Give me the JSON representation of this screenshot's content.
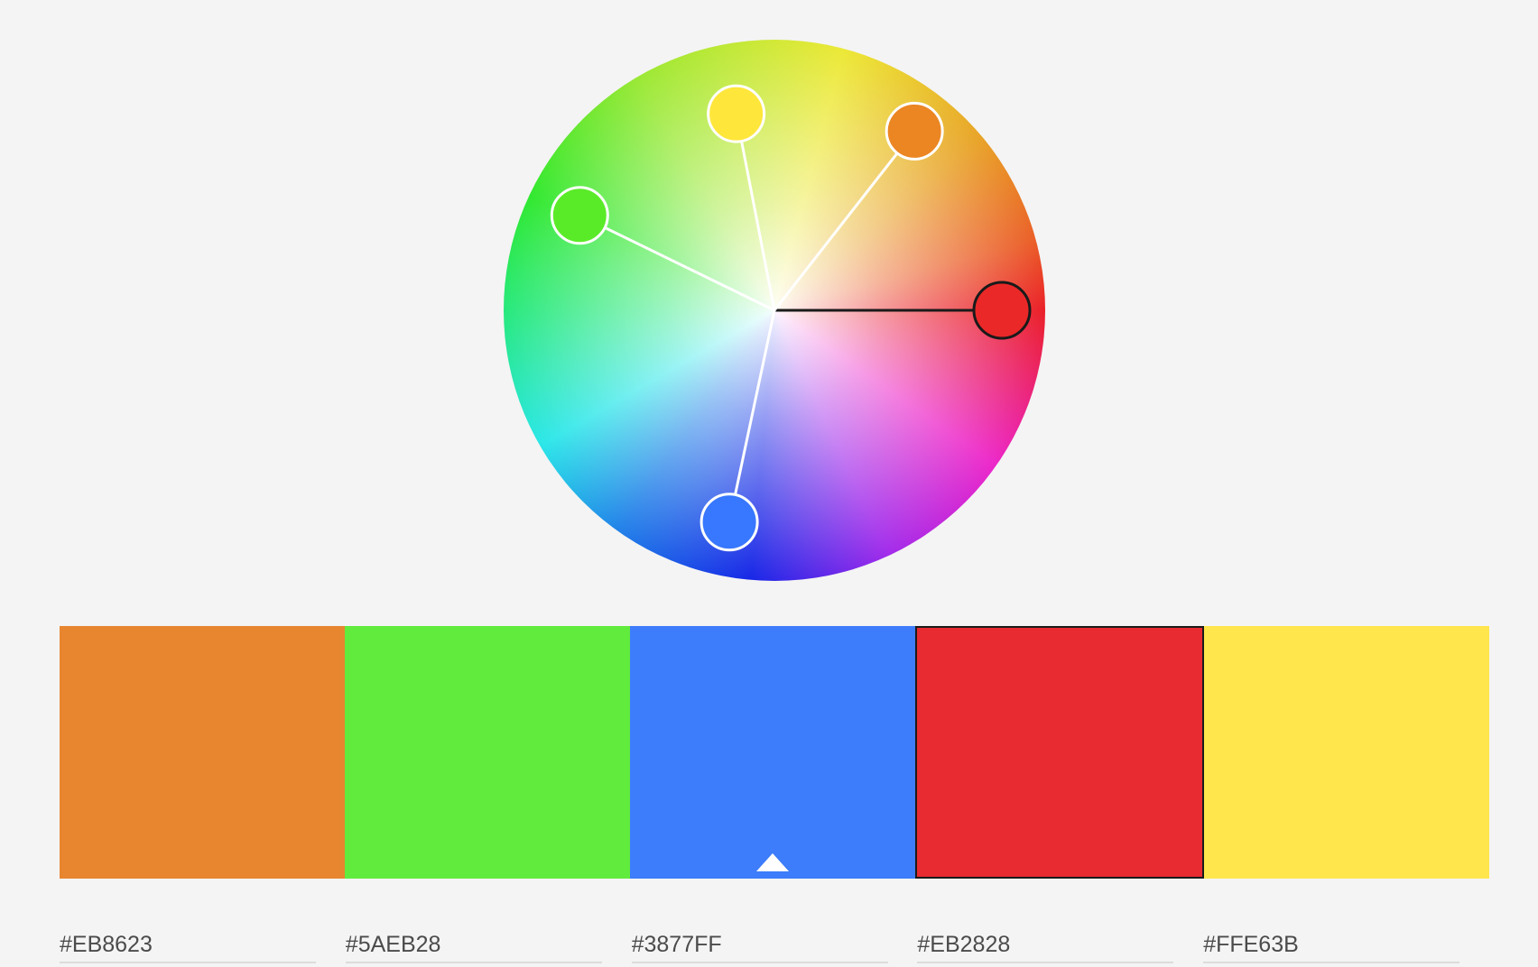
{
  "wheel": {
    "rule": "custom",
    "handles": [
      {
        "id": "handle-red",
        "color": "#EB2828",
        "angle_deg": 0,
        "radius_fraction": 0.84,
        "active": true
      },
      {
        "id": "handle-orange",
        "color": "#EB8623",
        "angle_deg": 52,
        "radius_fraction": 0.84,
        "active": false
      },
      {
        "id": "handle-yellow",
        "color": "#FFE63B",
        "angle_deg": 101,
        "radius_fraction": 0.74,
        "active": false
      },
      {
        "id": "handle-green",
        "color": "#5AEB28",
        "angle_deg": 154,
        "radius_fraction": 0.8,
        "active": false
      },
      {
        "id": "handle-blue",
        "color": "#3877FF",
        "angle_deg": 258,
        "radius_fraction": 0.8,
        "active": false
      }
    ]
  },
  "swatches": [
    {
      "hex": "#EB8623",
      "display": "#E8862F",
      "selected": false,
      "base": false
    },
    {
      "hex": "#5AEB28",
      "display": "#61EB3D",
      "selected": false,
      "base": false
    },
    {
      "hex": "#3877FF",
      "display": "#3D7CFA",
      "selected": false,
      "base": true
    },
    {
      "hex": "#EB2828",
      "display": "#E82A31",
      "selected": true,
      "base": false
    },
    {
      "hex": "#FFE63B",
      "display": "#FFE64D",
      "selected": false,
      "base": false
    }
  ],
  "colors": {
    "background": "#f4f4f4",
    "active_handle_stroke": "#1a1a1a",
    "inactive_handle_stroke": "#ffffff"
  },
  "icons": {
    "base_marker": "triangle-up-icon"
  }
}
